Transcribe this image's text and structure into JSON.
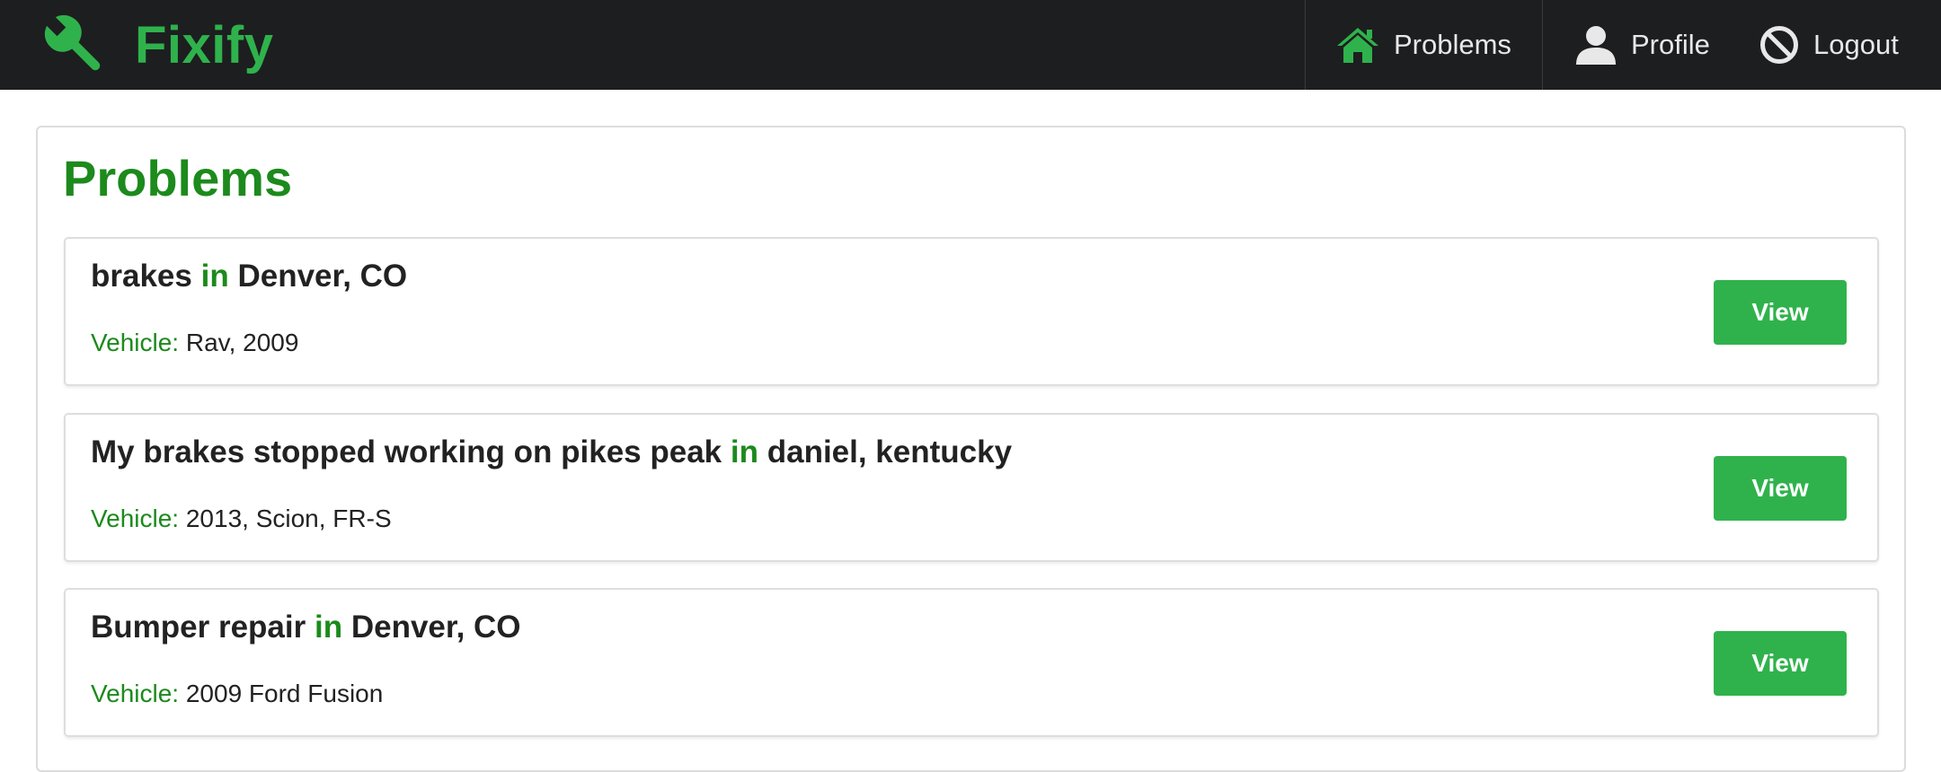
{
  "brand": {
    "name": "Fixify",
    "icon": "wrench-icon",
    "color": "#2fb24c"
  },
  "nav": {
    "problems": {
      "label": "Problems",
      "icon": "home-icon"
    },
    "profile": {
      "label": "Profile",
      "icon": "user-icon"
    },
    "logout": {
      "label": "Logout",
      "icon": "ban-icon"
    }
  },
  "page": {
    "title": "Problems",
    "accent_color": "#1c8a1c"
  },
  "problems": [
    {
      "title": "brakes",
      "connector": "in",
      "location": "Denver, CO",
      "vehicle_label": "Vehicle:",
      "vehicle": "Rav, 2009",
      "button": "View"
    },
    {
      "title": "My brakes stopped working on pikes peak",
      "connector": "in",
      "location": "daniel, kentucky",
      "vehicle_label": "Vehicle:",
      "vehicle": "2013, Scion, FR-S",
      "button": "View"
    },
    {
      "title": "Bumper repair",
      "connector": "in",
      "location": "Denver, CO",
      "vehicle_label": "Vehicle:",
      "vehicle": "2009 Ford Fusion",
      "button": "View"
    }
  ]
}
